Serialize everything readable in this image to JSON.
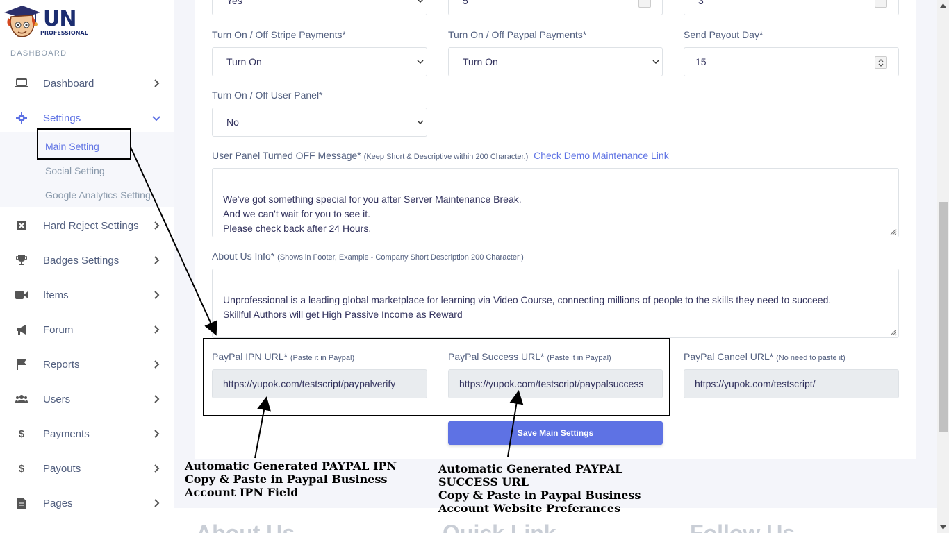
{
  "logo": {
    "text": "UN",
    "subtext": "PROFESSIONAL"
  },
  "sidebar": {
    "section_label": "DASHBOARD",
    "items": [
      {
        "label": "Dashboard",
        "icon": "laptop-icon"
      },
      {
        "label": "Settings",
        "icon": "gear-icon",
        "expanded": true
      },
      {
        "label": "Hard Reject Settings",
        "icon": "close-square-icon"
      },
      {
        "label": "Badges Settings",
        "icon": "trophy-icon"
      },
      {
        "label": "Items",
        "icon": "video-icon"
      },
      {
        "label": "Forum",
        "icon": "megaphone-icon"
      },
      {
        "label": "Reports",
        "icon": "flag-icon"
      },
      {
        "label": "Users",
        "icon": "users-icon"
      },
      {
        "label": "Payments",
        "icon": "dollar-icon"
      },
      {
        "label": "Payouts",
        "icon": "dollar-icon"
      },
      {
        "label": "Pages",
        "icon": "file-icon"
      }
    ],
    "submenu": [
      {
        "label": "Main Setting",
        "active": true
      },
      {
        "label": "Social Setting"
      },
      {
        "label": "Google Analytics Setting"
      }
    ]
  },
  "form": {
    "top_row": {
      "field1_value": "Yes",
      "field2_value": "5",
      "field3_value": "3"
    },
    "stripe": {
      "label": "Turn On / Off Stripe Payments*",
      "value": "Turn On"
    },
    "paypal": {
      "label": "Turn On / Off Paypal Payments*",
      "value": "Turn On"
    },
    "payout_day": {
      "label": "Send Payout Day*",
      "value": "15"
    },
    "user_panel": {
      "label": "Turn On / Off User Panel*",
      "value": "No"
    },
    "off_message": {
      "label": "User Panel Turned OFF Message*",
      "hint": "(Keep Short & Descriptive within 200 Character.)",
      "link": "Check Demo Maintenance Link",
      "value": "We've got something special for you after Server Maintenance Break.\nAnd we can't wait for you to see it.\nPlease check back after 24 Hours."
    },
    "about": {
      "label": "About Us Info*",
      "hint": "(Shows in Footer, Example - Company Short Description 200 Character.)",
      "value": "Unprofessional is a leading global marketplace for  learning via Video Course, connecting millions of people to the skills they need to succeed.\nSkillful Authors will get High Passive Income as Reward"
    },
    "ipn": {
      "label": "PayPal IPN URL*",
      "hint": "(Paste it in Paypal)",
      "value": "https://yupok.com/testscript/paypalverify"
    },
    "success": {
      "label": "PayPal Success URL*",
      "hint": "(Paste it in Paypal)",
      "value": "https://yupok.com/testscript/paypalsuccess"
    },
    "cancel": {
      "label": "PayPal Cancel URL*",
      "hint": "(No need to paste it)",
      "value": "https://yupok.com/testscript/"
    },
    "save_label": "Save Main Settings"
  },
  "footer": {
    "col1": "About Us",
    "col2": "Quick Link",
    "col3": "Follow Us"
  },
  "annotations": {
    "ipn_note": "Automatic Generated PAYPAL IPN\nCopy & Paste in Paypal Business\nAccount IPN Field",
    "success_note": "Automatic Generated PAYPAL\nSUCCESS URL\nCopy & Paste in Paypal Business\nAccount Website Preferances"
  },
  "colors": {
    "accent": "#5e72e4",
    "text": "#525f7f",
    "muted": "#8898aa"
  }
}
